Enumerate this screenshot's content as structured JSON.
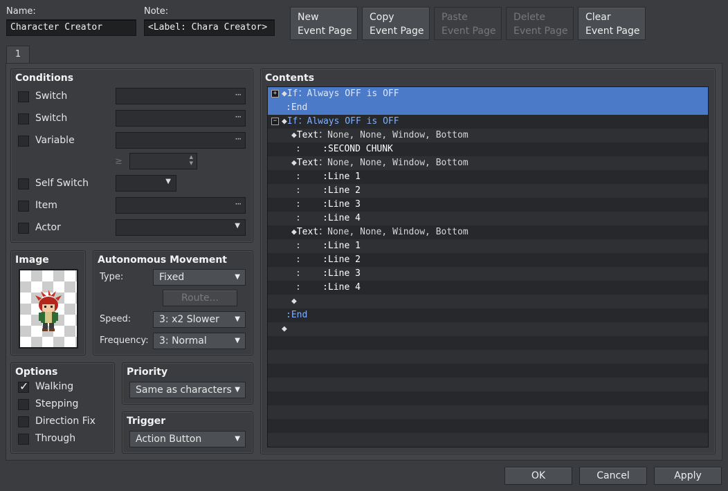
{
  "header": {
    "name_label": "Name:",
    "name_value": "Character Creator",
    "note_label": "Note:",
    "note_value": "<Label: Chara Creator>",
    "buttons": [
      {
        "line1": "New",
        "line2": "Event Page",
        "enabled": true
      },
      {
        "line1": "Copy",
        "line2": "Event Page",
        "enabled": true
      },
      {
        "line1": "Paste",
        "line2": "Event Page",
        "enabled": false
      },
      {
        "line1": "Delete",
        "line2": "Event Page",
        "enabled": false
      },
      {
        "line1": "Clear",
        "line2": "Event Page",
        "enabled": true
      }
    ]
  },
  "tabs": [
    {
      "label": "1"
    }
  ],
  "conditions": {
    "title": "Conditions",
    "switch1": {
      "label": "Switch",
      "checked": false,
      "value": ""
    },
    "switch2": {
      "label": "Switch",
      "checked": false,
      "value": ""
    },
    "variable": {
      "label": "Variable",
      "checked": false,
      "value": "",
      "operator": "≥",
      "number": ""
    },
    "self_switch": {
      "label": "Self Switch",
      "checked": false,
      "value": ""
    },
    "item": {
      "label": "Item",
      "checked": false,
      "value": ""
    },
    "actor": {
      "label": "Actor",
      "checked": false,
      "value": ""
    }
  },
  "image": {
    "title": "Image"
  },
  "movement": {
    "title": "Autonomous Movement",
    "type_label": "Type:",
    "type_value": "Fixed",
    "route_button": "Route...",
    "speed_label": "Speed:",
    "speed_value": "3: x2 Slower",
    "frequency_label": "Frequency:",
    "frequency_value": "3: Normal"
  },
  "options": {
    "title": "Options",
    "items": [
      {
        "label": "Walking",
        "checked": true
      },
      {
        "label": "Stepping",
        "checked": false
      },
      {
        "label": "Direction Fix",
        "checked": false
      },
      {
        "label": "Through",
        "checked": false
      }
    ]
  },
  "priority": {
    "title": "Priority",
    "value": "Same as characters"
  },
  "trigger": {
    "title": "Trigger",
    "value": "Action Button"
  },
  "contents": {
    "title": "Contents",
    "lines": [
      {
        "indent": 0,
        "marker": "◆",
        "kw": "If",
        "sep": "：",
        "text": "Always OFF is OFF",
        "toggle": "+",
        "selected": true
      },
      {
        "indent": 0,
        "marker": "",
        "kw": "End",
        "sep": "：",
        "text": "",
        "toggle": "",
        "selected": true
      },
      {
        "indent": 0,
        "marker": "◆",
        "kw": "If",
        "sep": "：",
        "text": "Always OFF is OFF",
        "toggle": "−",
        "selected": false
      },
      {
        "indent": 1,
        "marker": "◆",
        "kw": "Text",
        "sep": "：",
        "text": "None, None, Window, Bottom",
        "toggle": "",
        "selected": false
      },
      {
        "indent": 1,
        "marker": "",
        "kw": "",
        "sep": "：",
        "text": "SECOND CHUNK",
        "toggle": "",
        "selected": false,
        "cont": true
      },
      {
        "indent": 1,
        "marker": "◆",
        "kw": "Text",
        "sep": "：",
        "text": "None, None, Window, Bottom",
        "toggle": "",
        "selected": false
      },
      {
        "indent": 1,
        "marker": "",
        "kw": "",
        "sep": "：",
        "text": "Line 1",
        "toggle": "",
        "selected": false,
        "cont": true
      },
      {
        "indent": 1,
        "marker": "",
        "kw": "",
        "sep": "：",
        "text": "Line 2",
        "toggle": "",
        "selected": false,
        "cont": true
      },
      {
        "indent": 1,
        "marker": "",
        "kw": "",
        "sep": "：",
        "text": "Line 3",
        "toggle": "",
        "selected": false,
        "cont": true
      },
      {
        "indent": 1,
        "marker": "",
        "kw": "",
        "sep": "：",
        "text": "Line 4",
        "toggle": "",
        "selected": false,
        "cont": true
      },
      {
        "indent": 1,
        "marker": "◆",
        "kw": "Text",
        "sep": "：",
        "text": "None, None, Window, Bottom",
        "toggle": "",
        "selected": false
      },
      {
        "indent": 1,
        "marker": "",
        "kw": "",
        "sep": "：",
        "text": "Line 1",
        "toggle": "",
        "selected": false,
        "cont": true
      },
      {
        "indent": 1,
        "marker": "",
        "kw": "",
        "sep": "：",
        "text": "Line 2",
        "toggle": "",
        "selected": false,
        "cont": true
      },
      {
        "indent": 1,
        "marker": "",
        "kw": "",
        "sep": "：",
        "text": "Line 3",
        "toggle": "",
        "selected": false,
        "cont": true
      },
      {
        "indent": 1,
        "marker": "",
        "kw": "",
        "sep": "：",
        "text": "Line 4",
        "toggle": "",
        "selected": false,
        "cont": true
      },
      {
        "indent": 1,
        "marker": "◆",
        "kw": "",
        "sep": "",
        "text": "",
        "toggle": "",
        "selected": false
      },
      {
        "indent": 0,
        "marker": "",
        "kw": "End",
        "sep": "：",
        "text": "",
        "toggle": "",
        "selected": false
      },
      {
        "indent": 0,
        "marker": "◆",
        "kw": "",
        "sep": "",
        "text": "",
        "toggle": "",
        "selected": false
      }
    ]
  },
  "footer": {
    "ok": "OK",
    "cancel": "Cancel",
    "apply": "Apply"
  },
  "colors": {
    "selection": "#4a7ac8",
    "keyword": "#7fb0ff",
    "background": "#3a3c3f"
  }
}
